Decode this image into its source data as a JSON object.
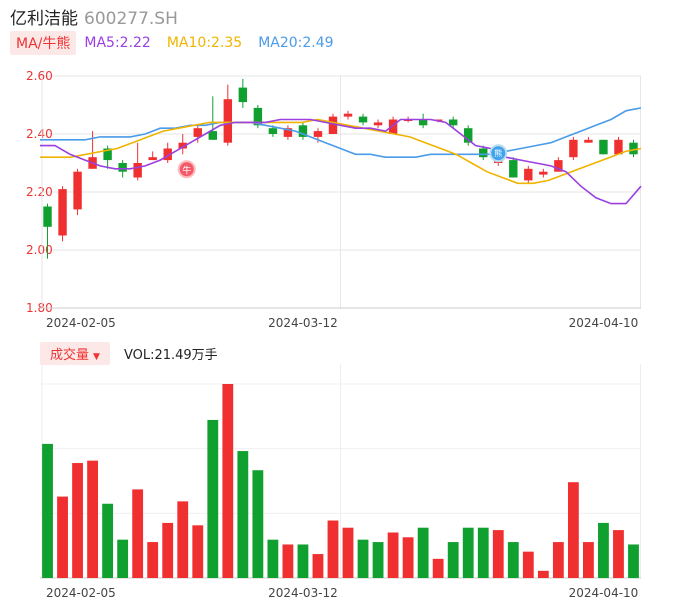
{
  "header": {
    "name": "亿利洁能",
    "code": "600277.SH"
  },
  "legend": {
    "mode_label": "MA/牛熊",
    "ma5": {
      "label": "MA5:2.22",
      "color": "#9b3fe0"
    },
    "ma10": {
      "label": "MA10:2.35",
      "color": "#f0b400"
    },
    "ma20": {
      "label": "MA20:2.49",
      "color": "#4a9be8"
    }
  },
  "volume_legend": {
    "button_label": "成交量",
    "caret": "▼",
    "value": "VOL:21.49万手"
  },
  "colors": {
    "up": "#f03030",
    "down": "#10a030"
  },
  "icons": {
    "bull_marker": "牛",
    "bear_marker": "熊"
  },
  "chart_data": [
    {
      "type": "candlestick",
      "y_ticks": [
        "2.60",
        "2.40",
        "2.20",
        "2.00",
        "1.80"
      ],
      "ylim": [
        1.8,
        2.6
      ],
      "x_ticks": [
        {
          "label": "2024-02-05",
          "index": 0
        },
        {
          "label": "2024-03-12",
          "index": 17
        },
        {
          "label": "2024-04-10",
          "index": 37
        }
      ],
      "candles": [
        [
          2.15,
          2.08,
          2.16,
          1.97
        ],
        [
          2.05,
          2.21,
          2.22,
          2.03
        ],
        [
          2.14,
          2.27,
          2.28,
          2.12
        ],
        [
          2.28,
          2.32,
          2.41,
          2.28
        ],
        [
          2.35,
          2.31,
          2.36,
          2.28
        ],
        [
          2.3,
          2.27,
          2.31,
          2.25
        ],
        [
          2.25,
          2.3,
          2.37,
          2.24
        ],
        [
          2.31,
          2.32,
          2.34,
          2.31
        ],
        [
          2.31,
          2.35,
          2.37,
          2.3
        ],
        [
          2.35,
          2.37,
          2.4,
          2.33
        ],
        [
          2.39,
          2.42,
          2.43,
          2.37
        ],
        [
          2.41,
          2.38,
          2.53,
          2.38
        ],
        [
          2.37,
          2.52,
          2.57,
          2.36
        ],
        [
          2.56,
          2.51,
          2.59,
          2.49
        ],
        [
          2.49,
          2.43,
          2.5,
          2.42
        ],
        [
          2.42,
          2.4,
          2.43,
          2.39
        ],
        [
          2.39,
          2.42,
          2.43,
          2.38
        ],
        [
          2.43,
          2.39,
          2.44,
          2.38
        ],
        [
          2.39,
          2.41,
          2.42,
          2.37
        ],
        [
          2.4,
          2.46,
          2.47,
          2.4
        ],
        [
          2.46,
          2.47,
          2.48,
          2.45
        ],
        [
          2.46,
          2.44,
          2.47,
          2.43
        ],
        [
          2.43,
          2.44,
          2.45,
          2.42
        ],
        [
          2.4,
          2.45,
          2.46,
          2.4
        ],
        [
          2.45,
          2.45,
          2.46,
          2.44
        ],
        [
          2.45,
          2.43,
          2.47,
          2.42
        ],
        [
          2.45,
          2.45,
          2.45,
          2.44
        ],
        [
          2.45,
          2.43,
          2.46,
          2.42
        ],
        [
          2.42,
          2.37,
          2.43,
          2.36
        ],
        [
          2.35,
          2.32,
          2.36,
          2.31
        ],
        [
          2.3,
          2.31,
          2.32,
          2.29
        ],
        [
          2.31,
          2.25,
          2.32,
          2.25
        ],
        [
          2.24,
          2.28,
          2.29,
          2.23
        ],
        [
          2.26,
          2.27,
          2.28,
          2.25
        ],
        [
          2.27,
          2.31,
          2.32,
          2.27
        ],
        [
          2.32,
          2.38,
          2.39,
          2.31
        ],
        [
          2.37,
          2.38,
          2.39,
          2.37
        ],
        [
          2.38,
          2.33,
          2.38,
          2.33
        ],
        [
          2.33,
          2.38,
          2.39,
          2.33
        ],
        [
          2.37,
          2.33,
          2.38,
          2.32
        ]
      ],
      "ma5": [
        2.36,
        2.36,
        2.33,
        2.31,
        2.29,
        2.28,
        2.28,
        2.29,
        2.31,
        2.34,
        2.37,
        2.4,
        2.43,
        2.44,
        2.44,
        2.44,
        2.45,
        2.45,
        2.45,
        2.44,
        2.43,
        2.42,
        2.42,
        2.41,
        2.45,
        2.45,
        2.45,
        2.44,
        2.4,
        2.36,
        2.35,
        2.32,
        2.31,
        2.3,
        2.29,
        2.27,
        2.22,
        2.18,
        2.16,
        2.16,
        2.22
      ],
      "ma10": [
        2.32,
        2.32,
        2.32,
        2.33,
        2.34,
        2.35,
        2.37,
        2.39,
        2.41,
        2.42,
        2.43,
        2.44,
        2.44,
        2.44,
        2.44,
        2.44,
        2.44,
        2.44,
        2.45,
        2.44,
        2.43,
        2.42,
        2.41,
        2.4,
        2.39,
        2.37,
        2.35,
        2.33,
        2.3,
        2.27,
        2.25,
        2.23,
        2.23,
        2.24,
        2.26,
        2.28,
        2.3,
        2.32,
        2.34,
        2.35
      ],
      "ma20": [
        2.38,
        2.38,
        2.38,
        2.38,
        2.39,
        2.39,
        2.39,
        2.4,
        2.42,
        2.42,
        2.43,
        2.43,
        2.44,
        2.44,
        2.44,
        2.43,
        2.42,
        2.41,
        2.39,
        2.37,
        2.35,
        2.33,
        2.33,
        2.32,
        2.32,
        2.32,
        2.33,
        2.33,
        2.33,
        2.33,
        2.33,
        2.34,
        2.35,
        2.36,
        2.37,
        2.39,
        2.41,
        2.43,
        2.45,
        2.48,
        2.49
      ],
      "bull_marker_index": 9,
      "bear_marker_index": 30
    },
    {
      "type": "bar",
      "name": "volume",
      "x_ticks": [
        {
          "label": "2024-02-05",
          "index": 0
        },
        {
          "label": "2024-03-12",
          "index": 17
        },
        {
          "label": "2024-04-10",
          "index": 37
        }
      ],
      "values": [
        56,
        34,
        48,
        49,
        31,
        16,
        37,
        15,
        23,
        32,
        22,
        66,
        81,
        53,
        45,
        16,
        14,
        14,
        10,
        24,
        21,
        16,
        15,
        19,
        17,
        21,
        8,
        15,
        21,
        21,
        20,
        15,
        11,
        3,
        15,
        40,
        15,
        23,
        20,
        14
      ],
      "directions": [
        "down",
        "up",
        "up",
        "up",
        "down",
        "down",
        "up",
        "up",
        "up",
        "up",
        "up",
        "down",
        "up",
        "down",
        "down",
        "down",
        "up",
        "down",
        "up",
        "up",
        "up",
        "down",
        "down",
        "up",
        "up",
        "down",
        "up",
        "down",
        "down",
        "down",
        "up",
        "down",
        "up",
        "up",
        "up",
        "up",
        "up",
        "down",
        "up",
        "down"
      ]
    }
  ]
}
